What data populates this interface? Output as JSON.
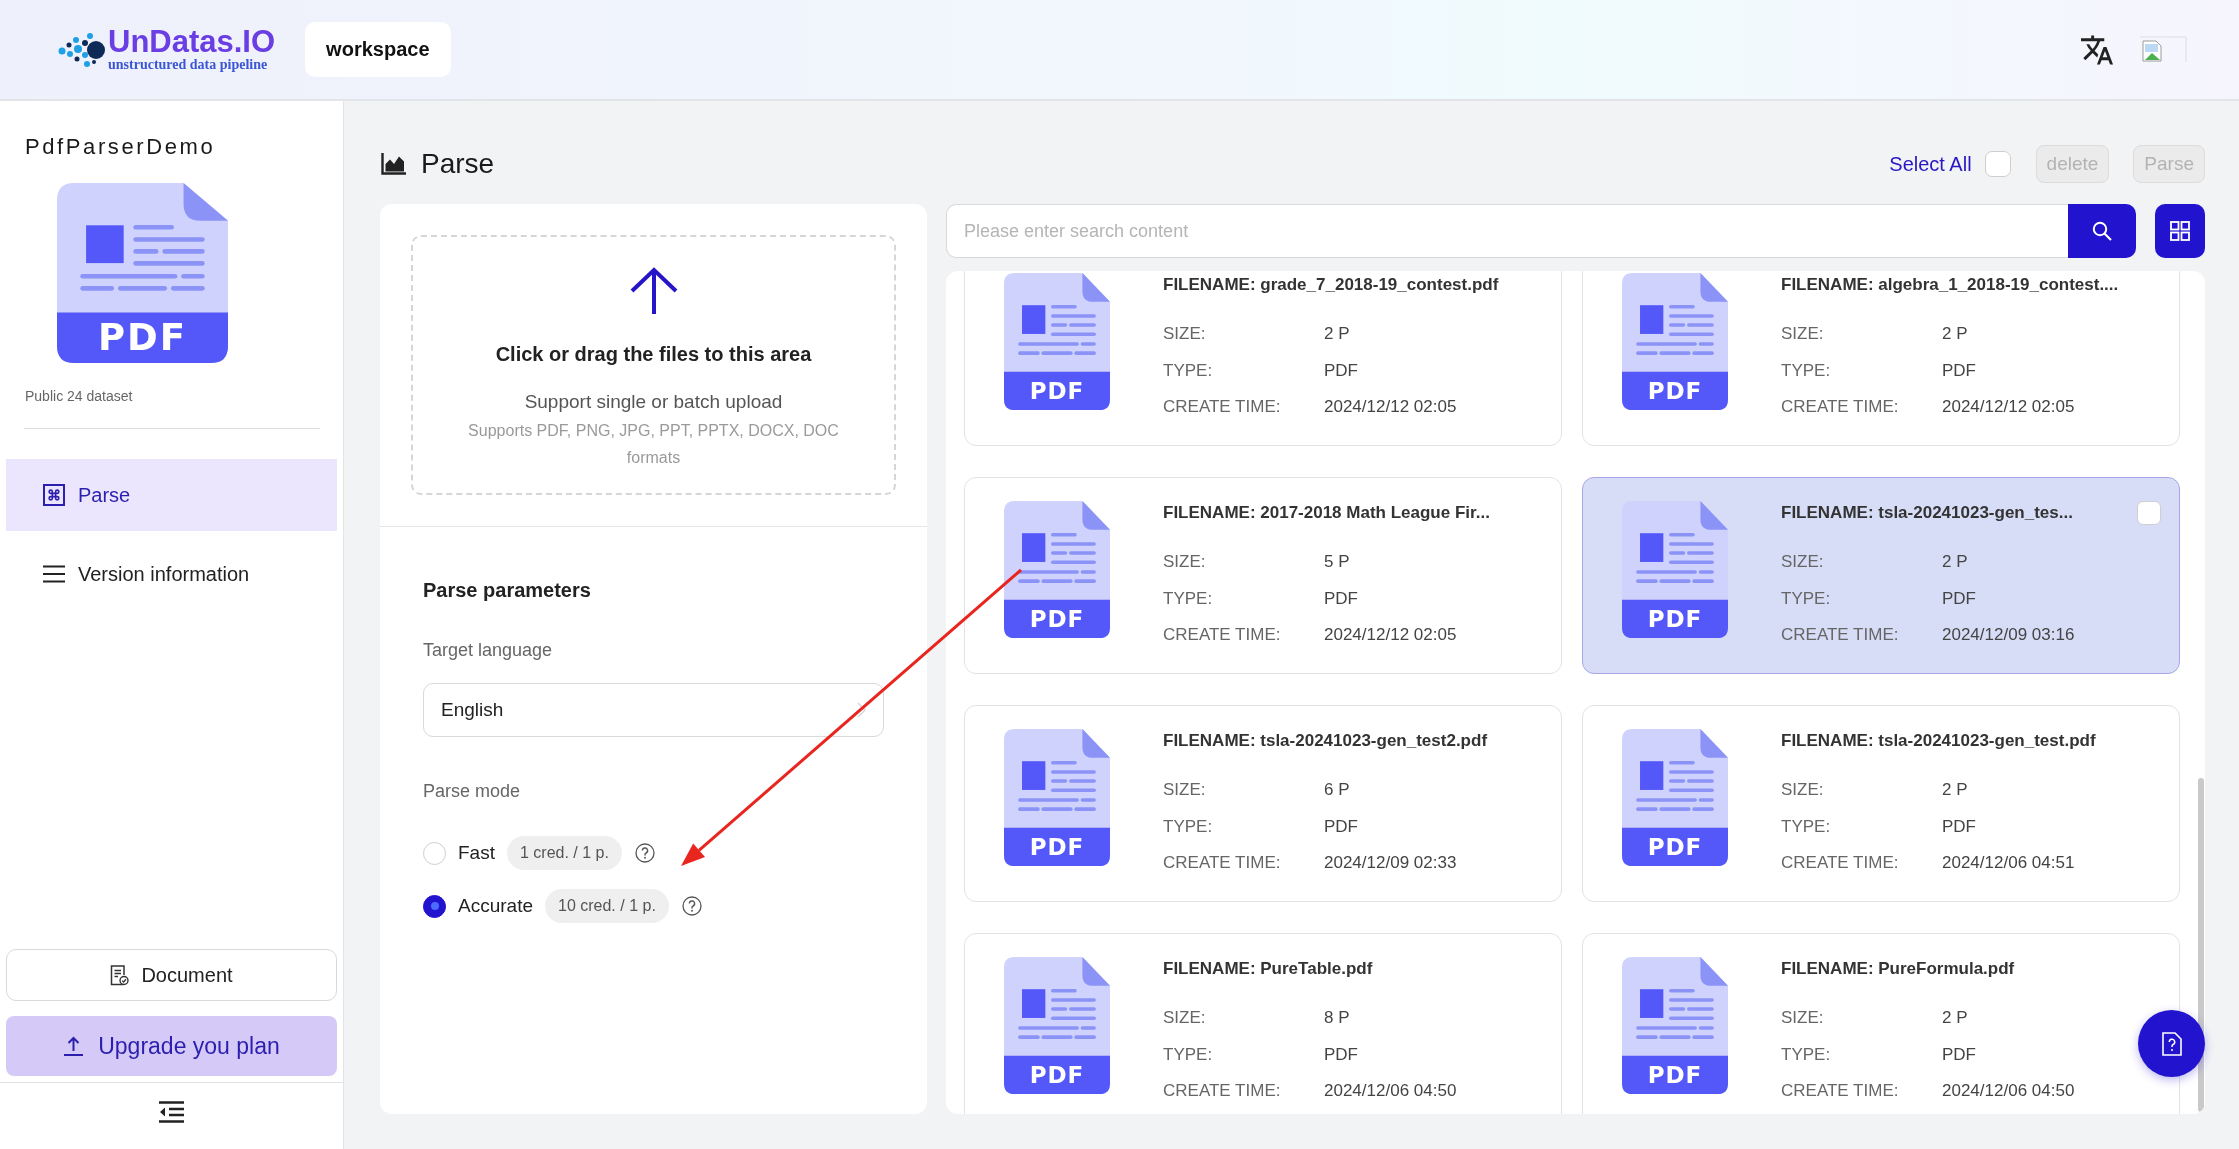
{
  "header": {
    "logo_name": "UnDatas.IO",
    "logo_tagline": "unstructured data pipeline",
    "workspace_button": "workspace"
  },
  "sidebar": {
    "project_title": "PdfParserDemo",
    "dataset_icon_label": "PDF",
    "dataset_info": "Public 24 dataset",
    "menu": [
      {
        "label": "Parse",
        "selected": true
      },
      {
        "label": "Version information",
        "selected": false
      }
    ],
    "document_button": "Document",
    "upgrade_button": "Upgrade you plan"
  },
  "toolbar": {
    "title": "Parse",
    "select_all": {
      "label": "Select All",
      "checked": false
    },
    "actions": [
      {
        "label": "delete",
        "disabled": true
      },
      {
        "label": "Parse",
        "disabled": true
      }
    ]
  },
  "upload": {
    "title": "Click or drag the files to this area",
    "hint": "Support single or batch upload",
    "formats": "Supports PDF, PNG, JPG, PPT, PPTX, DOCX, DOC formats"
  },
  "parameters": {
    "title": "Parse parameters",
    "language_label": "Target language",
    "language_value": "English",
    "mode_label": "Parse mode",
    "modes": [
      {
        "label": "Fast",
        "cost": "1 cred. / 1 p.",
        "selected": false
      },
      {
        "label": "Accurate",
        "cost": "10 cred. / 1 p.",
        "selected": true
      }
    ]
  },
  "search": {
    "placeholder": "Please enter search content"
  },
  "files": [
    {
      "title": "FILENAME: grade_7_2018-19_contest.pdf",
      "icon_label": "PDF",
      "fields": [
        {
          "label": "SIZE:",
          "value": "2 P"
        },
        {
          "label": "TYPE:",
          "value": "PDF"
        },
        {
          "label": "CREATE TIME:",
          "value": "2024/12/12 02:05"
        }
      ],
      "hovered": false,
      "checked": false
    },
    {
      "title": "FILENAME: algebra_1_2018-19_contest....",
      "icon_label": "PDF",
      "fields": [
        {
          "label": "SIZE:",
          "value": "2 P"
        },
        {
          "label": "TYPE:",
          "value": "PDF"
        },
        {
          "label": "CREATE TIME:",
          "value": "2024/12/12 02:05"
        }
      ],
      "hovered": false,
      "checked": false
    },
    {
      "title": "FILENAME: 2017-2018 Math League Fir...",
      "icon_label": "PDF",
      "fields": [
        {
          "label": "SIZE:",
          "value": "5 P"
        },
        {
          "label": "TYPE:",
          "value": "PDF"
        },
        {
          "label": "CREATE TIME:",
          "value": "2024/12/12 02:05"
        }
      ],
      "hovered": false,
      "checked": false
    },
    {
      "title": "FILENAME: tsla-20241023-gen_tes...",
      "icon_label": "PDF",
      "fields": [
        {
          "label": "SIZE:",
          "value": "2 P"
        },
        {
          "label": "TYPE:",
          "value": "PDF"
        },
        {
          "label": "CREATE TIME:",
          "value": "2024/12/09 03:16"
        }
      ],
      "hovered": true,
      "checked": false
    },
    {
      "title": "FILENAME: tsla-20241023-gen_test2.pdf",
      "icon_label": "PDF",
      "fields": [
        {
          "label": "SIZE:",
          "value": "6 P"
        },
        {
          "label": "TYPE:",
          "value": "PDF"
        },
        {
          "label": "CREATE TIME:",
          "value": "2024/12/09 02:33"
        }
      ],
      "hovered": false,
      "checked": false
    },
    {
      "title": "FILENAME: tsla-20241023-gen_test.pdf",
      "icon_label": "PDF",
      "fields": [
        {
          "label": "SIZE:",
          "value": "2 P"
        },
        {
          "label": "TYPE:",
          "value": "PDF"
        },
        {
          "label": "CREATE TIME:",
          "value": "2024/12/06 04:51"
        }
      ],
      "hovered": false,
      "checked": false
    },
    {
      "title": "FILENAME: PureTable.pdf",
      "icon_label": "PDF",
      "fields": [
        {
          "label": "SIZE:",
          "value": "8 P"
        },
        {
          "label": "TYPE:",
          "value": "PDF"
        },
        {
          "label": "CREATE TIME:",
          "value": "2024/12/06 04:50"
        }
      ],
      "hovered": false,
      "checked": false
    },
    {
      "title": "FILENAME: PureFormula.pdf",
      "icon_label": "PDF",
      "fields": [
        {
          "label": "SIZE:",
          "value": "2 P"
        },
        {
          "label": "TYPE:",
          "value": "PDF"
        },
        {
          "label": "CREATE TIME:",
          "value": "2024/12/06 04:50"
        }
      ],
      "hovered": false,
      "checked": false
    }
  ]
}
